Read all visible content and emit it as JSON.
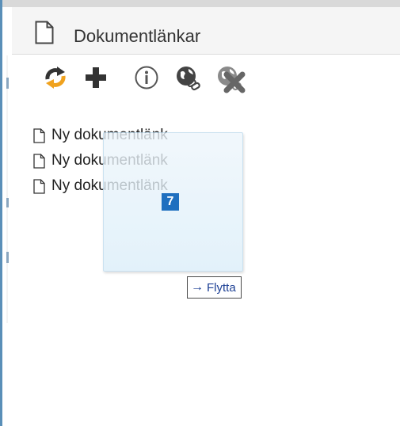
{
  "header": {
    "title": "Dokumentlänkar"
  },
  "toolbar": {
    "icons": [
      "refresh-icon",
      "plus-icon",
      "info-icon",
      "globe-link-icon",
      "globe-link-icon",
      "close-icon"
    ]
  },
  "documents": [
    {
      "label": "Ny dokumentlänk"
    },
    {
      "label": "Ny dokumentlänk"
    },
    {
      "label": "Ny dokumentlänk"
    }
  ],
  "drag": {
    "count": "7",
    "tooltip": "Flytta",
    "tooltip_arrow": "→"
  },
  "colors": {
    "accent_blue": "#1f6fbf",
    "refresh_orange": "#f0a21e",
    "icon_dark": "#333333",
    "tooltip_text": "#1c3f94"
  }
}
